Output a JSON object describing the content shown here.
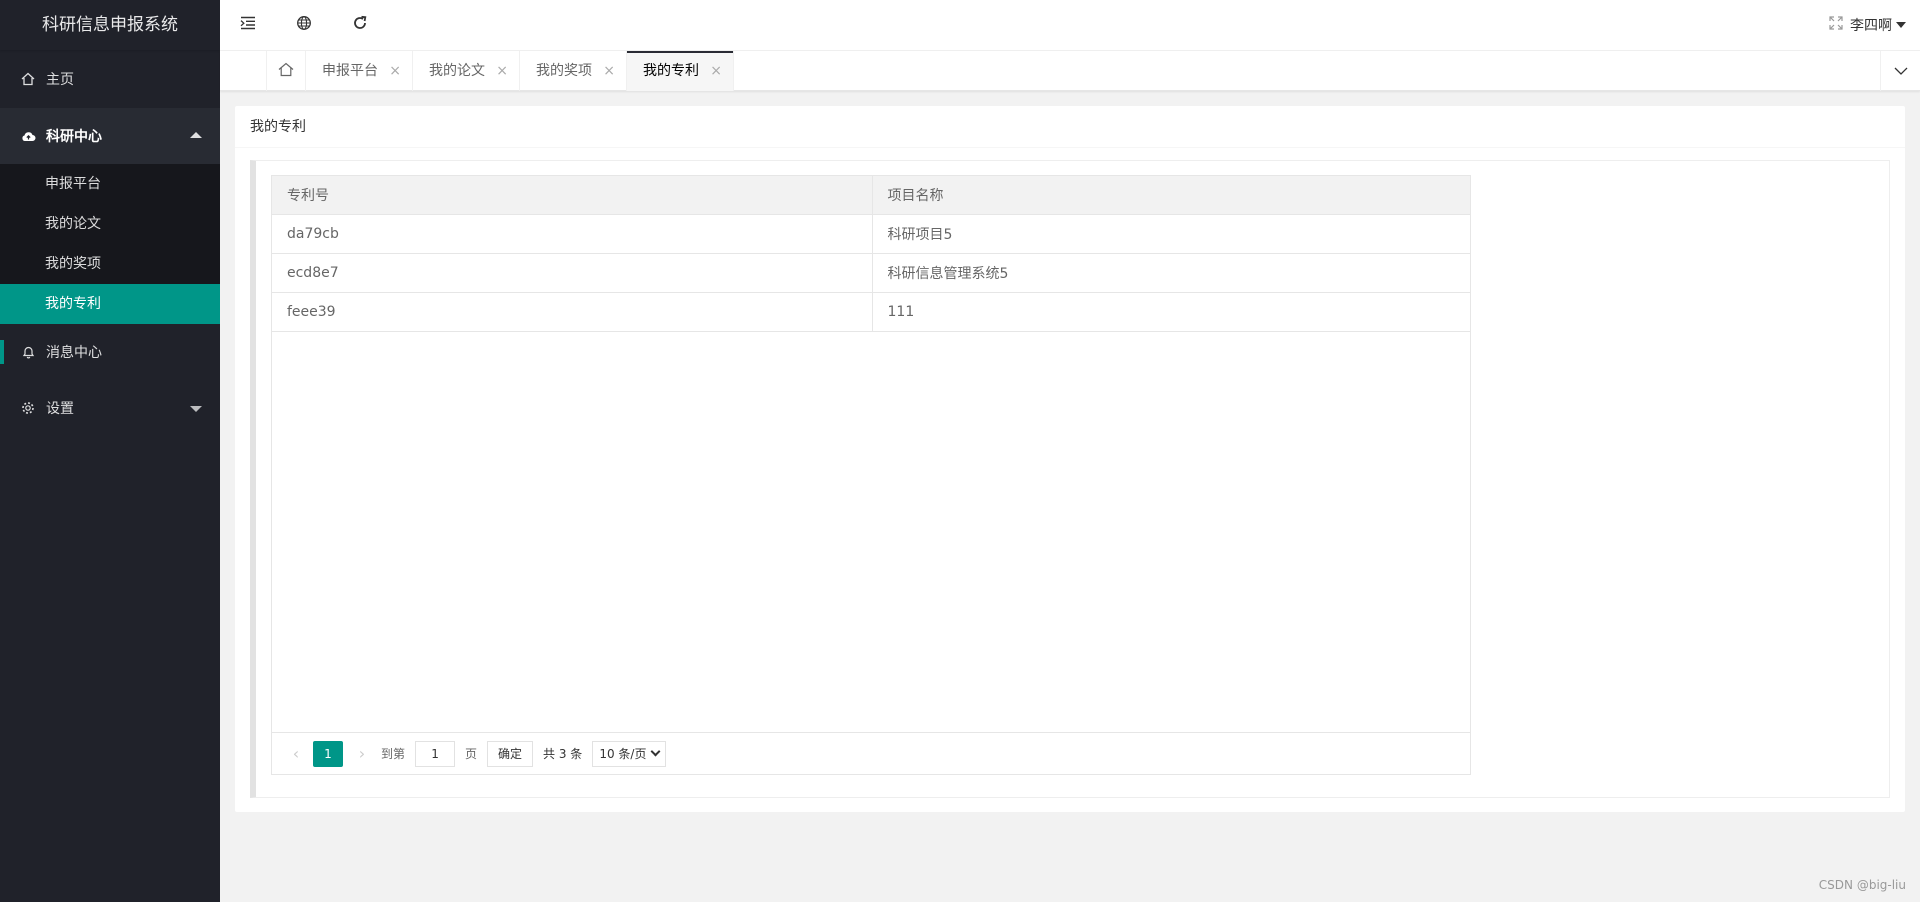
{
  "app": {
    "title": "科研信息申报系统"
  },
  "sidebar": {
    "home": "主页",
    "research": {
      "label": "科研中心",
      "items": [
        "申报平台",
        "我的论文",
        "我的奖项",
        "我的专利"
      ]
    },
    "messages": "消息中心",
    "settings": "设置"
  },
  "header": {
    "user": "李四啊"
  },
  "tabs": [
    "申报平台",
    "我的论文",
    "我的奖项",
    "我的专利"
  ],
  "tab_close": "×",
  "panel": {
    "title": "我的专利"
  },
  "table": {
    "headers": [
      "专利号",
      "项目名称"
    ],
    "rows": [
      [
        "da79cb",
        "科研项目5"
      ],
      [
        "ecd8e7",
        "科研信息管理系统5"
      ],
      [
        "feee39",
        "111"
      ]
    ]
  },
  "pager": {
    "current": "1",
    "goto_label": "到第",
    "goto_value": "1",
    "page_label": "页",
    "confirm": "确定",
    "total": "共 3 条",
    "page_size": "10 条/页"
  },
  "watermark": "CSDN @big-liu",
  "colors": {
    "accent": "#009688",
    "sidebar": "#20222a"
  }
}
